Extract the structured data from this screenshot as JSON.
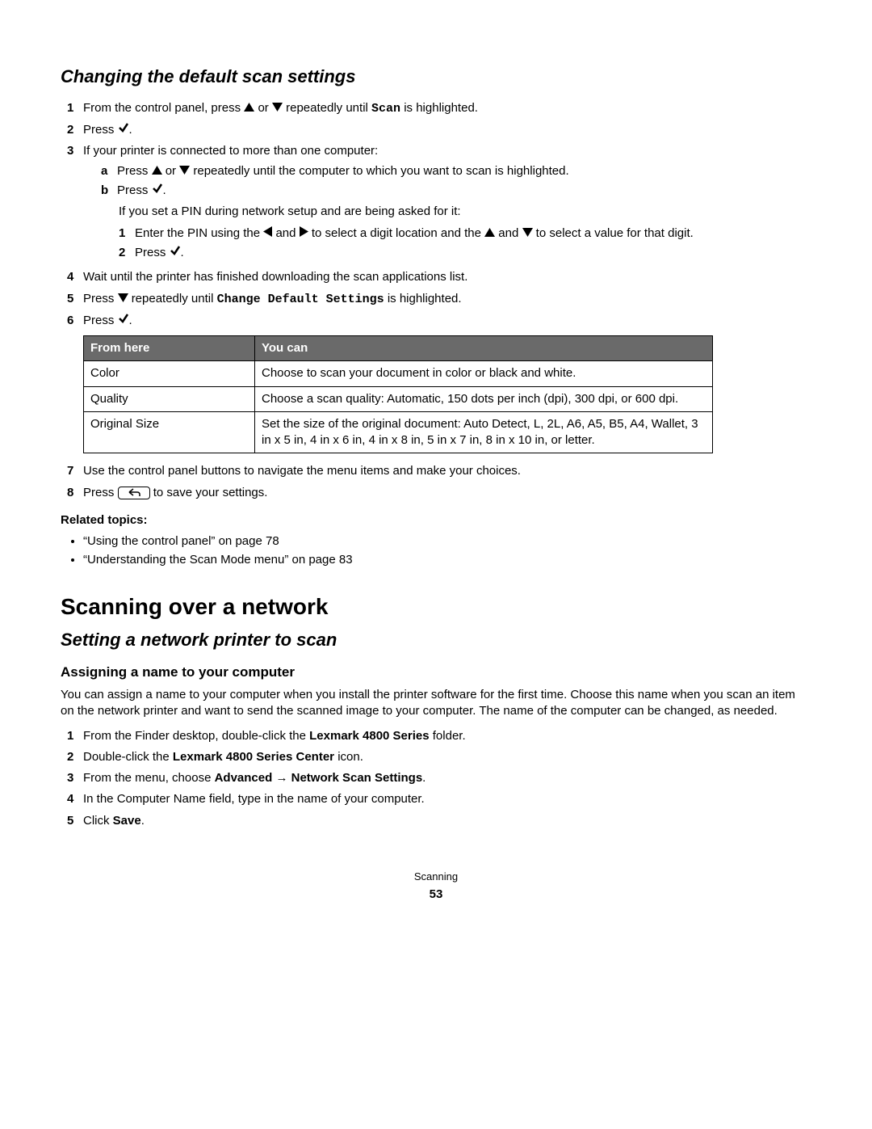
{
  "section1": {
    "title": "Changing the default scan settings",
    "steps": {
      "s1": {
        "pre": "From the control panel, press ",
        "mid": " or ",
        "post": " repeatedly until ",
        "label": "Scan",
        "end": " is highlighted."
      },
      "s2": {
        "pre": "Press ",
        "end": "."
      },
      "s3": {
        "text": "If your printer is connected to more than one computer:",
        "a": {
          "pre": "Press ",
          "mid": " or ",
          "post": " repeatedly until the computer to which you want to scan is highlighted."
        },
        "b": {
          "pre": "Press ",
          "end": "."
        },
        "note": "If you set a PIN during network setup and are being asked for it:",
        "inner1": {
          "pre": "Enter the PIN using the ",
          "mid1": " and ",
          "mid2": " to select a digit location and the ",
          "mid3": " and ",
          "post": " to select a value for that digit."
        },
        "inner2": {
          "pre": "Press ",
          "end": "."
        }
      },
      "s4": "Wait until the printer has finished downloading the scan applications list.",
      "s5": {
        "pre": "Press ",
        "mid": " repeatedly until ",
        "label": "Change Default Settings",
        "post": " is highlighted."
      },
      "s6": {
        "pre": "Press ",
        "end": "."
      },
      "s7": "Use the control panel buttons to navigate the menu items and make your choices.",
      "s8": {
        "pre": "Press ",
        "post": " to save your settings."
      }
    },
    "table": {
      "headers": [
        "From here",
        "You can"
      ],
      "rows": [
        [
          "Color",
          "Choose to scan your document in color or black and white."
        ],
        [
          "Quality",
          "Choose a scan quality: Automatic, 150 dots per inch (dpi), 300 dpi, or 600 dpi."
        ],
        [
          "Original Size",
          "Set the size of the original document: Auto Detect, L, 2L, A6, A5, B5, A4, Wallet, 3 in x 5 in, 4 in x 6 in, 4 in x 8 in, 5 in x 7 in, 8 in x 10 in, or letter."
        ]
      ]
    },
    "related": {
      "title": "Related topics:",
      "items": [
        "“Using the control panel” on page 78",
        "“Understanding the Scan Mode menu” on page 83"
      ]
    }
  },
  "section2": {
    "title": "Scanning over a network",
    "sub": "Setting a network printer to scan",
    "subsub": "Assigning a name to your computer",
    "intro": "You can assign a name to your computer when you install the printer software for the first time. Choose this name when you scan an item on the network printer and want to send the scanned image to your computer. The name of the computer can be changed, as needed.",
    "steps": {
      "s1": {
        "pre": "From the Finder desktop, double-click the ",
        "bold": "Lexmark 4800 Series",
        "post": " folder."
      },
      "s2": {
        "pre": "Double-click the ",
        "bold": "Lexmark 4800 Series Center",
        "post": " icon."
      },
      "s3": {
        "pre": "From the menu, choose ",
        "bold1": "Advanced",
        "arrow": " → ",
        "bold2": "Network Scan Settings",
        "post": "."
      },
      "s4": "In the Computer Name field, type in the name of your computer.",
      "s5": {
        "pre": "Click ",
        "bold": "Save",
        "post": "."
      }
    }
  },
  "footer": {
    "chapter": "Scanning",
    "page": "53"
  }
}
